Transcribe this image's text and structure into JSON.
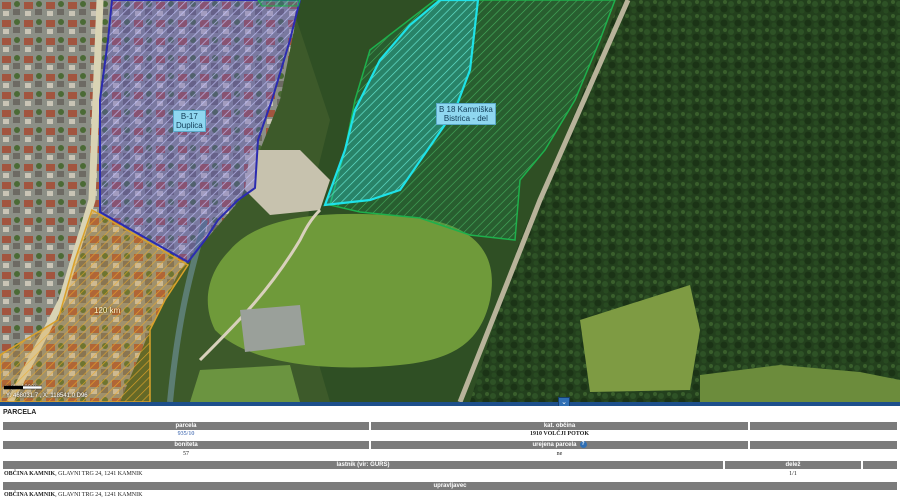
{
  "map": {
    "labels": {
      "b17": [
        "B-17",
        "Duplica"
      ],
      "b18": [
        "B 18 Kamniška",
        "Bistrica - del"
      ],
      "orange": "120 km"
    },
    "scale_text": "m (1 : 1890)",
    "coords_text": "Y: 468031.7 , X: 118541.0  D96"
  },
  "panel": {
    "toggle_icon": "chevron-down-icon",
    "title": "PARCELA",
    "parcela_label": "parcela",
    "parcela_value": "935/10",
    "kat_obcina_label": "kat. občina",
    "kat_obcina_value": "1910 VOLČJI POTOK",
    "boniteta_label": "boniteta",
    "boniteta_value": "57",
    "urejena_parcela_label": "urejena parcela",
    "urejena_parcela_value": "ne",
    "lastnik_label": "lastnik (vir: GURS)",
    "delez_label": "delež",
    "owner_name": "OBČINA KAMNIK",
    "owner_address": ", GLAVNI TRG 24, 1241 KAMNIK",
    "delez_value": "1/1",
    "upravljavec_label": "upravljavec",
    "upravljavec_name": "OBČINA KAMNIK",
    "upravljavec_address": ", GLAVNI TRG 24, 1241 KAMNIK"
  }
}
